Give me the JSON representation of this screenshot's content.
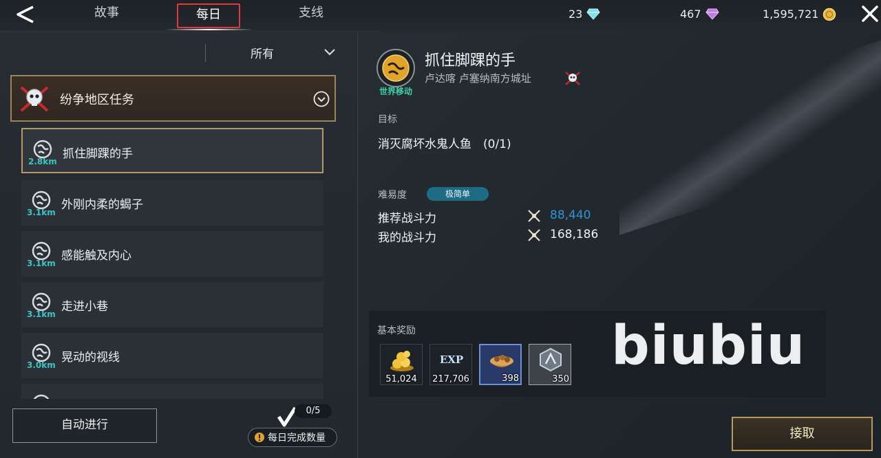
{
  "tabs": [
    {
      "label": "故事"
    },
    {
      "label": "每日"
    },
    {
      "label": "支线"
    }
  ],
  "currencies": [
    {
      "value": "23",
      "icon": "diamond-blue-icon"
    },
    {
      "value": "467",
      "icon": "diamond-purple-icon"
    },
    {
      "value": "1,595,721",
      "icon": "gold-coin-icon"
    }
  ],
  "filter": {
    "label": "所有"
  },
  "category": {
    "label": "纷争地区任务"
  },
  "quests": [
    {
      "name": "抓住脚踝的手",
      "distance": "2.8km"
    },
    {
      "name": "外刚内柔的蝎子",
      "distance": "3.1km"
    },
    {
      "name": "感能触及内心",
      "distance": "3.1km"
    },
    {
      "name": "走进小巷",
      "distance": "3.1km"
    },
    {
      "name": "晃动的视线",
      "distance": "3.0km"
    }
  ],
  "bottom": {
    "auto_label": "自动进行",
    "daily_counter": "0/5",
    "daily_label": "每日完成数量"
  },
  "detail": {
    "type_label": "世界移动",
    "title": "抓住脚踝的手",
    "location": "卢达喀 卢塞纳南方城址",
    "goal_label": "目标",
    "goal_text": "消灭腐坏水鬼人鱼　(0/1)",
    "difficulty_label": "难易度",
    "difficulty_value": "极简单",
    "recommended_label": "推荐战斗力",
    "recommended_value": "88,440",
    "my_label": "我的战斗力",
    "my_value": "168,186",
    "reward_label": "基本奖励",
    "rewards": [
      {
        "count": "51,024",
        "icon": "gold-pile-icon"
      },
      {
        "count": "217,706",
        "icon": "exp-icon"
      },
      {
        "count": "398",
        "icon": "nuts-bowl-icon"
      },
      {
        "count": "350",
        "icon": "crystal-badge-icon"
      }
    ],
    "accept_label": "接取"
  },
  "watermark": "biubiu",
  "colors": {
    "accent_red": "#e23a3a",
    "gold_border": "#b89a5e",
    "distance_cyan": "#38c5c3",
    "recommended_blue": "#2e95d8",
    "world_green": "#3fd1a1"
  }
}
